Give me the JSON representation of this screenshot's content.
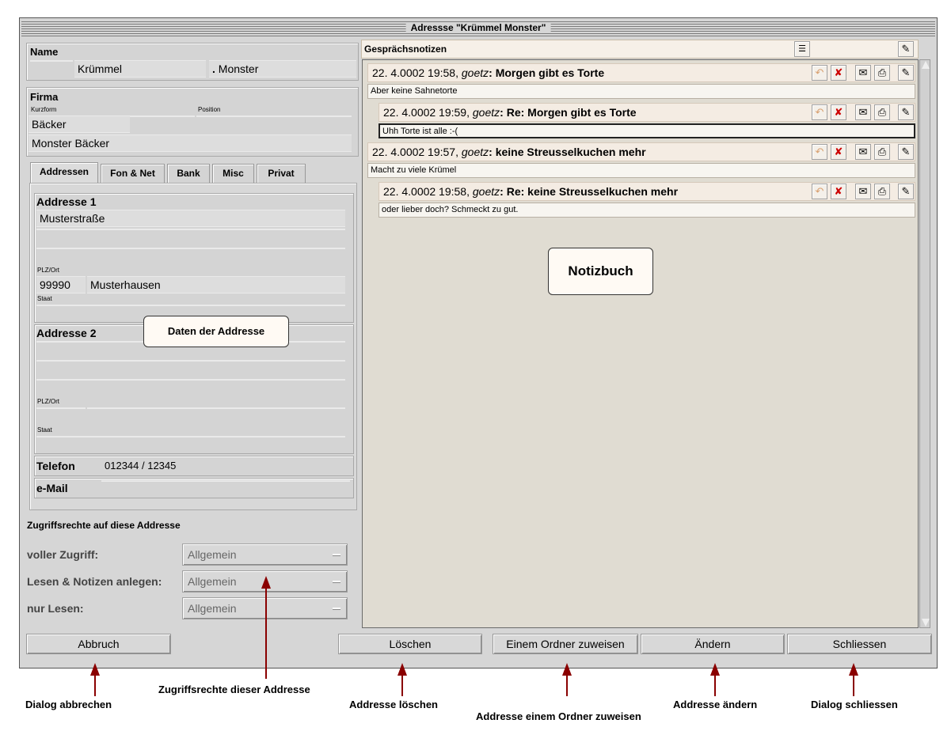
{
  "window": {
    "title": "Adressse \"Krümmel Monster\""
  },
  "name_section": {
    "label": "Name",
    "first": "Krümmel",
    "separator": ".",
    "last": "Monster"
  },
  "company_section": {
    "label": "Firma",
    "short_label": "Kurzform",
    "position_label": "Position",
    "short": "Bäcker",
    "position": "",
    "full": "Monster Bäcker"
  },
  "tabs": [
    {
      "label": "Addressen",
      "active": true
    },
    {
      "label": "Fon & Net",
      "active": false
    },
    {
      "label": "Bank",
      "active": false
    },
    {
      "label": "Misc",
      "active": false
    },
    {
      "label": "Privat",
      "active": false
    }
  ],
  "address1": {
    "label": "Addresse 1",
    "line1": "Musterstraße",
    "line2": "",
    "line3": "",
    "zip_label": "PLZ/Ort",
    "zip": "99990",
    "city": "Musterhausen",
    "state_label": "Staat",
    "state": ""
  },
  "address2": {
    "label": "Addresse 2",
    "line1": "",
    "line2": "",
    "line3": "",
    "zip_label": "PLZ/Ort",
    "zip": "",
    "city": "",
    "state_label": "Staat",
    "state": ""
  },
  "phone": {
    "label": "Telefon",
    "value": "012344 / 12345"
  },
  "email": {
    "label": "e-Mail",
    "value": ""
  },
  "access": {
    "heading": "Zugriffsrechte auf diese Addresse",
    "rows": [
      {
        "label": "voller Zugriff:",
        "value": "Allgemein"
      },
      {
        "label": "Lesen & Notizen anlegen:",
        "value": "Allgemein"
      },
      {
        "label": "nur Lesen:",
        "value": "Allgemein"
      }
    ]
  },
  "notes": {
    "heading": "Gesprächsnotizen",
    "items": [
      {
        "date": "22. 4.0002 19:58,",
        "author": "goetz",
        "title": "Morgen gibt es Torte",
        "body": "Aber keine Sahnetorte"
      },
      {
        "date": "22. 4.0002 19:59,",
        "author": "goetz",
        "title": "Re:  Morgen gibt es Torte",
        "body": "Uhh Torte ist alle :-("
      },
      {
        "date": "22. 4.0002 19:57,",
        "author": "goetz",
        "title": "keine Streusselkuchen mehr",
        "body": "Macht zu viele Krümel"
      },
      {
        "date": "22. 4.0002 19:58,",
        "author": "goetz",
        "title": "Re:  keine Streusselkuchen mehr",
        "body": "oder lieber doch? Schmeckt zu gut."
      }
    ]
  },
  "buttons": {
    "cancel": "Abbruch",
    "delete": "Löschen",
    "assign": "Einem Ordner zuweisen",
    "change": "Ändern",
    "close": "Schliessen"
  },
  "callouts": {
    "address_data": "Daten der Addresse",
    "notebook": "Notizbuch"
  },
  "annotations": {
    "cancel": "Dialog abbrechen",
    "rights": "Zugriffsrechte dieser Addresse",
    "delete": "Addresse löschen",
    "assign": "Addresse einem Ordner zuweisen",
    "change": "Addresse ändern",
    "close": "Dialog schliessen"
  },
  "icons": {
    "list": "list-icon",
    "edit": "edit-icon",
    "reply": "reply-icon",
    "delete": "delete-x-icon",
    "mail": "mail-icon",
    "print": "print-icon"
  },
  "colors": {
    "note_header": "#f4ece3",
    "note_panel": "#e0dcd2",
    "arrow": "#8a0000"
  }
}
